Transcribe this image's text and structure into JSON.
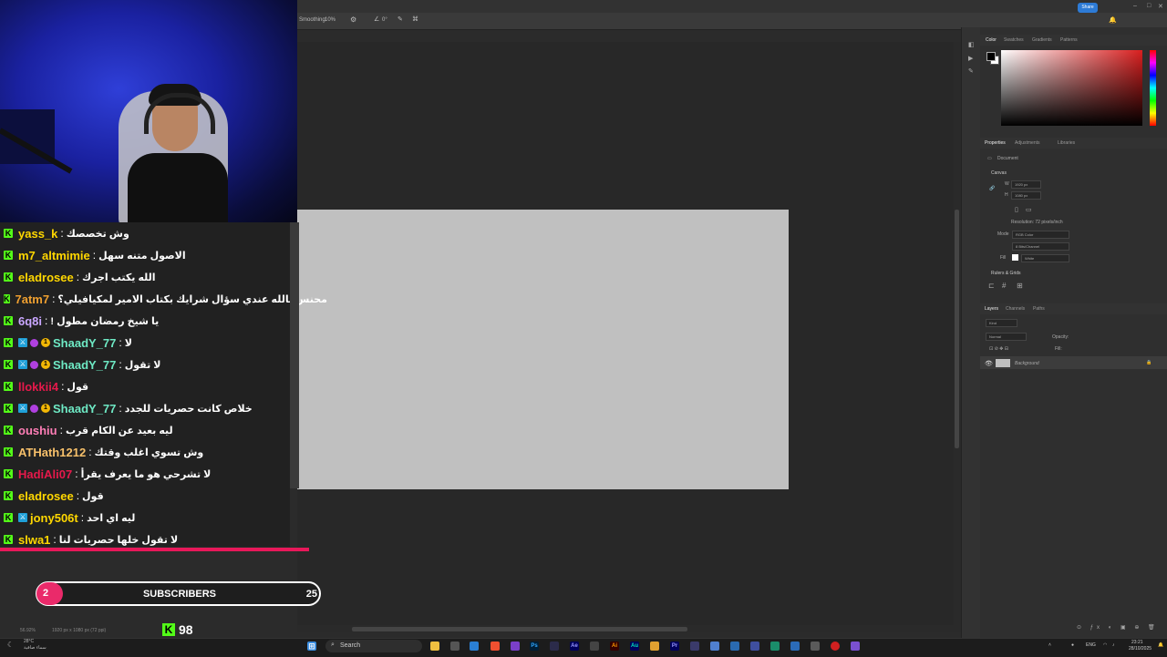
{
  "photoshop": {
    "options_bar": {
      "smoothing_label": "Smoothing:",
      "smoothing_value": "10%",
      "angle_value": "0°"
    },
    "share_label": "Share",
    "color_panel": {
      "tabs": [
        "Color",
        "Swatches",
        "Gradients",
        "Patterns"
      ]
    },
    "properties_panel": {
      "tabs": [
        "Properties",
        "Adjustments",
        "Libraries"
      ],
      "document_label": "Document",
      "canvas_section": "Canvas",
      "width_label": "W",
      "width_value": "1920 px",
      "height_label": "H",
      "height_value": "1080 px",
      "resolution": "Resolution: 72 pixels/inch",
      "mode_label": "Mode",
      "mode_value": "RGB Color",
      "bit_depth": "8 Bits/Channel",
      "fill_label": "Fill",
      "fill_value": "White",
      "rulers_section": "Rulers & Grids"
    },
    "layers_panel": {
      "tabs": [
        "Layers",
        "Channels",
        "Paths"
      ],
      "search_placeholder": "Kind",
      "blend_mode": "Normal",
      "opacity_label": "Opacity:",
      "fill_label": "Fill:",
      "layer_name": "Background"
    },
    "status": {
      "zoom": "56.92%",
      "doc_size": "1920 px x 1080 px (72 ppi)"
    }
  },
  "taskbar": {
    "weather_temp": "28°C",
    "weather_desc": "سماء صافية",
    "search_placeholder": "Search",
    "language": "ENG",
    "time": "23:21",
    "date": "28/10/2025",
    "apps": [
      {
        "label": "Ps",
        "color": "#31a8ff"
      },
      {
        "label": "Ae",
        "color": "#9999ff"
      },
      {
        "label": "Ai",
        "color": "#ff9a00"
      },
      {
        "label": "Au",
        "color": "#00e4bb"
      },
      {
        "label": "Pr",
        "color": "#9999ff"
      }
    ]
  },
  "chat": {
    "messages": [
      {
        "user": "yass_k",
        "color": "#ffd700",
        "badges": [],
        "text": "وش تخصصك"
      },
      {
        "user": "m7_altmimie",
        "color": "#ffd700",
        "badges": [],
        "text": "الاصول متنه سهل"
      },
      {
        "user": "eladrosee",
        "color": "#ffd700",
        "badges": [],
        "text": "الله يكتب اجرك"
      },
      {
        "user": "7atm7",
        "color": "#f0a030",
        "badges": [],
        "text": "محنس بالله عندي سؤال شرايك بكتاب الامير لمكيافيلي؟"
      },
      {
        "user": "6q8i",
        "color": "#c9a6ff",
        "badges": [],
        "text": "يا شيخ رمضان مطول !"
      },
      {
        "user": "ShaadY_77",
        "color": "#6ee9c4",
        "badges": [
          "mod",
          "sub",
          "og"
        ],
        "text": "لا"
      },
      {
        "user": "ShaadY_77",
        "color": "#6ee9c4",
        "badges": [
          "mod",
          "sub",
          "og"
        ],
        "text": "لا تقول"
      },
      {
        "user": "llokkii4",
        "color": "#e6194b",
        "badges": [],
        "text": "قول"
      },
      {
        "user": "ShaadY_77",
        "color": "#6ee9c4",
        "badges": [
          "mod",
          "sub",
          "og"
        ],
        "text": "خلاص كانت حصريات للجدد"
      },
      {
        "user": "oushiu",
        "color": "#ff7eb6",
        "badges": [],
        "text": "ليه بعيد عن الكام قرب"
      },
      {
        "user": "ATHath1212",
        "color": "#f7c06a",
        "badges": [],
        "text": "وش تسوي اغلب وقتك"
      },
      {
        "user": "HadiAli07",
        "color": "#e6194b",
        "badges": [],
        "text": "لا تشرحي هو ما يعرف يقرأ"
      },
      {
        "user": "eladrosee",
        "color": "#ffd700",
        "badges": [],
        "text": "قول"
      },
      {
        "user": "jony506t",
        "color": "#ffd700",
        "badges": [
          "mod"
        ],
        "text": "ليه اي احد"
      },
      {
        "user": "slwa1",
        "color": "#ffd700",
        "badges": [],
        "text": "لا تقول خلها حصريات لنا"
      }
    ]
  },
  "subscribers": {
    "current": "2",
    "label": "SUBSCRIBERS",
    "goal": "25"
  },
  "viewers": {
    "count": "98"
  },
  "colors": {
    "kick_green": "#53fc18",
    "accent_pink": "#ea2a6a",
    "ps_blue": "#2d7bd6"
  }
}
